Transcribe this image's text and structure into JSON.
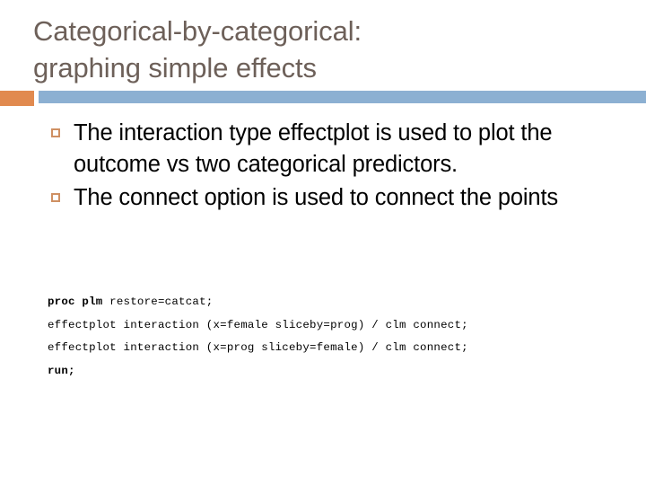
{
  "slide": {
    "title_lines": [
      "Categorical-by-categorical:",
      "graphing simple effects"
    ],
    "colors": {
      "title_text": "#6d6059",
      "accent_orange": "#e18a4f",
      "divider_blue": "#8cb0d2",
      "bullet_marker": "#cf9063",
      "body_text": "#000000",
      "background": "#ffffff"
    },
    "bullets": [
      {
        "marker": "hollow-square-bullet",
        "text": "The interaction type effectplot is used to plot the outcome vs two categorical predictors."
      },
      {
        "marker": "hollow-square-bullet",
        "text": "The connect option is used to connect the points"
      }
    ],
    "code": {
      "language": "sas",
      "lines": [
        {
          "keyword": "proc plm",
          "rest": " restore=catcat;"
        },
        {
          "keyword": "",
          "rest": "effectplot interaction (x=female sliceby=prog) / clm connect;"
        },
        {
          "keyword": "",
          "rest": "effectplot interaction (x=prog sliceby=female) / clm connect;"
        },
        {
          "keyword": "run;",
          "rest": ""
        }
      ]
    }
  }
}
